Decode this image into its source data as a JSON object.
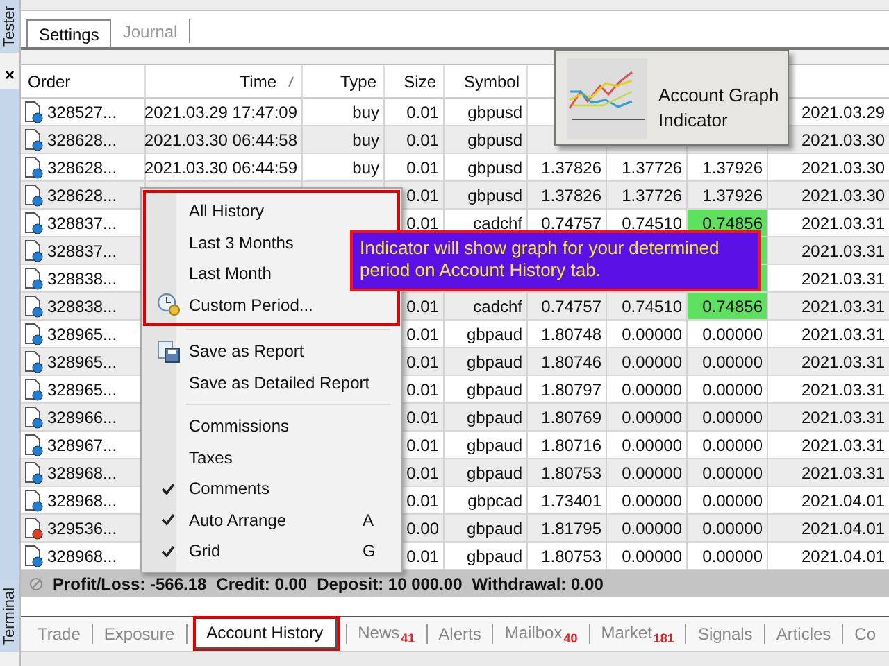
{
  "side": {
    "top_label": "Tester",
    "close": "×",
    "bottom_label": "Terminal"
  },
  "top_tabs": [
    {
      "label": "Settings",
      "selected": true
    },
    {
      "label": "Journal",
      "selected": false
    }
  ],
  "table": {
    "columns": [
      "Order",
      "Time",
      "Type",
      "Size",
      "Symbol"
    ],
    "rows": [
      {
        "order": "328527...",
        "color": "#1e7fd8",
        "time": "2021.03.29 17:47:09",
        "type": "buy",
        "size": "0.01",
        "symbol": "gbpusd",
        "column_9": "2021.03.29"
      },
      {
        "order": "328628...",
        "color": "#1e7fd8",
        "time": "2021.03.30 06:44:58",
        "type": "buy",
        "size": "0.01",
        "symbol": "gbpusd",
        "column_9": "2021.03.30"
      },
      {
        "order": "328628...",
        "color": "#1e7fd8",
        "time": "2021.03.30 06:44:59",
        "type": "buy",
        "size": "0.01",
        "symbol": "gbpusd",
        "column_6": "1.37826",
        "column_7": "1.37726",
        "column_8": "1.37926",
        "highlighted": false,
        "column_9": "2021.03.30"
      },
      {
        "order": "328628...",
        "color": "#1e7fd8",
        "size": "0.01",
        "symbol": "gbpusd",
        "column_6": "1.37826",
        "column_7": "1.37726",
        "column_8": "1.37926",
        "highlighted": false,
        "column_9": "2021.03.30"
      },
      {
        "order": "328837...",
        "color": "#1e7fd8",
        "size": "0.01",
        "symbol": "cadchf",
        "column_6": "0.74757",
        "column_7": "0.74510",
        "column_8": "0.74856",
        "highlighted": true,
        "column_9": "2021.03.31"
      },
      {
        "order": "328837...",
        "color": "#1e7fd8",
        "highlighted": true,
        "column_9": "2021.03.31"
      },
      {
        "order": "328838...",
        "color": "#1e7fd8",
        "highlighted": true,
        "column_9": "2021.03.31"
      },
      {
        "order": "328838...",
        "color": "#1e7fd8",
        "size": "0.01",
        "symbol": "cadchf",
        "column_6": "0.74757",
        "column_7": "0.74510",
        "column_8": "0.74856",
        "highlighted": true,
        "column_9": "2021.03.31"
      },
      {
        "order": "328965...",
        "color": "#1e7fd8",
        "size": "0.01",
        "symbol": "gbpaud",
        "column_6": "1.80748",
        "column_7": "0.00000",
        "column_8": "0.00000",
        "highlighted": false,
        "column_9": "2021.03.31"
      },
      {
        "order": "328965...",
        "color": "#1e7fd8",
        "size": "0.01",
        "symbol": "gbpaud",
        "column_6": "1.80746",
        "column_7": "0.00000",
        "column_8": "0.00000",
        "highlighted": false,
        "column_9": "2021.03.31"
      },
      {
        "order": "328965...",
        "color": "#1e7fd8",
        "size": "0.01",
        "symbol": "gbpaud",
        "column_6": "1.80797",
        "column_7": "0.00000",
        "column_8": "0.00000",
        "highlighted": false,
        "column_9": "2021.03.31"
      },
      {
        "order": "328966...",
        "color": "#1e7fd8",
        "size": "0.01",
        "symbol": "gbpaud",
        "column_6": "1.80769",
        "column_7": "0.00000",
        "column_8": "0.00000",
        "highlighted": false,
        "column_9": "2021.03.31"
      },
      {
        "order": "328967...",
        "color": "#1e7fd8",
        "size": "0.01",
        "symbol": "gbpaud",
        "column_6": "1.80716",
        "column_7": "0.00000",
        "column_8": "0.00000",
        "highlighted": false,
        "column_9": "2021.03.31"
      },
      {
        "order": "328968...",
        "color": "#1e7fd8",
        "size": "0.01",
        "symbol": "gbpaud",
        "column_6": "1.80753",
        "column_7": "0.00000",
        "column_8": "0.00000",
        "highlighted": false,
        "column_9": "2021.03.31"
      },
      {
        "order": "328968...",
        "color": "#1e7fd8",
        "size": "0.01",
        "symbol": "gbpcad",
        "column_6": "1.73401",
        "column_7": "0.00000",
        "column_8": "0.00000",
        "highlighted": false,
        "column_9": "2021.04.01"
      },
      {
        "order": "329536...",
        "color": "#e0401a",
        "size": "0.00",
        "symbol": "gbpaud",
        "column_6": "1.81795",
        "column_7": "0.00000",
        "column_8": "0.00000",
        "highlighted": false,
        "column_9": "2021.04.01"
      },
      {
        "order": "328968...",
        "color": "#1e7fd8",
        "size": "0.01",
        "symbol": "gbpaud",
        "column_6": "1.80753",
        "column_7": "0.00000",
        "column_8": "0.00000",
        "highlighted": false,
        "column_9": "2021.04.01"
      }
    ]
  },
  "summary": [
    "Profit/Loss: -566.18",
    "Credit: 0.00",
    "Deposit: 10 000.00",
    "Withdrawal: 0.00"
  ],
  "bottom_tabs": [
    {
      "label": "Trade",
      "selected": false
    },
    {
      "label": "Exposure",
      "selected": false
    },
    {
      "label": "Account History",
      "selected": true
    },
    {
      "label": "News",
      "badge": "41",
      "selected": false
    },
    {
      "label": "Alerts",
      "selected": false
    },
    {
      "label": "Mailbox",
      "badge": "40",
      "selected": false
    },
    {
      "label": "Market",
      "badge": "181",
      "selected": false
    },
    {
      "label": "Signals",
      "selected": false
    },
    {
      "label": "Articles",
      "selected": false
    },
    {
      "label": "Co",
      "selected": false
    }
  ],
  "context_menu": {
    "groups": [
      {
        "outlined": true,
        "items": [
          {
            "label": "All History",
            "checked": false
          },
          {
            "label": "Last 3 Months",
            "checked": false
          },
          {
            "label": "Last Month",
            "checked": false
          },
          {
            "label": "Custom Period...",
            "kind": "clock",
            "checked": false
          }
        ]
      },
      {
        "outlined": false,
        "items": [
          {
            "label": "Save as Report",
            "kind": "save",
            "checked": false
          },
          {
            "label": "Save as Detailed Report",
            "checked": false
          }
        ]
      },
      {
        "outlined": false,
        "items": [
          {
            "label": "Commissions",
            "checked": false
          },
          {
            "label": "Taxes",
            "checked": false
          },
          {
            "label": "Comments",
            "checked": true
          },
          {
            "label": "Auto Arrange",
            "shortcut": "A",
            "checked": true
          },
          {
            "label": "Grid",
            "shortcut": "G",
            "checked": true
          }
        ]
      }
    ]
  },
  "callout": {
    "text": "Indicator will show graph for your determined period on Account History tab."
  },
  "indicator_popup": {
    "title": "Account Graph Indicator"
  }
}
